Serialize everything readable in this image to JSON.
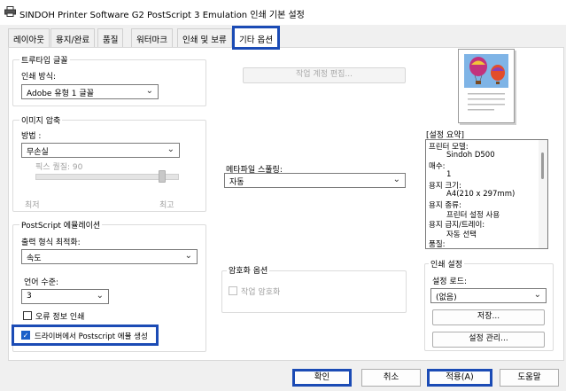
{
  "window": {
    "title": "SINDOH Printer Software G2 PostScript 3 Emulation 인쇄 기본 설정"
  },
  "tabs": [
    {
      "label": "레이아웃"
    },
    {
      "label": "용지/완료"
    },
    {
      "label": "품질"
    },
    {
      "label": "워터마크"
    },
    {
      "label": "인쇄 및 보류"
    },
    {
      "label": "기타 옵션"
    }
  ],
  "truetype": {
    "group_label": "트루타입 글꼴",
    "method_label": "인쇄 방식:",
    "method_value": "Adobe 유형 1 글꼴"
  },
  "job_account_button": "작업 계정 편집...",
  "image_compression": {
    "group_label": "이미지 압축",
    "method_label": "방법 :",
    "method_value": "무손실",
    "slider_label": "픽스 퀄질: 90",
    "slider_value": 90,
    "min_label": "최저",
    "max_label": "최고"
  },
  "metafile": {
    "label": "메타파일 스풀링:",
    "value": "자동"
  },
  "postscript": {
    "group_label": "PostScript 에뮬레이션",
    "output_label": "출력 형식 최적화:",
    "output_value": "속도",
    "level_label": "언어 수준:",
    "level_value": "3",
    "error_label": "오류 정보 인쇄",
    "driver_error_label": "드라이버에서 Postscript 에뮬 생성"
  },
  "encryption": {
    "group_label": "암호화 옵션",
    "job_encrypt_label": "작업 암호화"
  },
  "summary": {
    "header": "[설정 요약]",
    "lines": [
      "프린터 모델:",
      "Sindoh D500",
      "매수:",
      "1",
      "용지 크기:",
      "A4(210 x 297mm)",
      "용지 종류:",
      "프린터 설정 사용",
      "용지 급지/트레이:",
      "자동 선택",
      "품질:"
    ]
  },
  "print_settings": {
    "group_label": "인쇄 설정",
    "load_label": "설정 로드:",
    "load_value": "(없음)",
    "save_button": "저장...",
    "manage_button": "설정 관리..."
  },
  "footer": {
    "ok": "확인",
    "cancel": "취소",
    "apply": "적용(A)",
    "help": "도움말"
  },
  "colors": {
    "highlight": "#1b4bb5",
    "checkbox_on": "#1a5fc8"
  }
}
